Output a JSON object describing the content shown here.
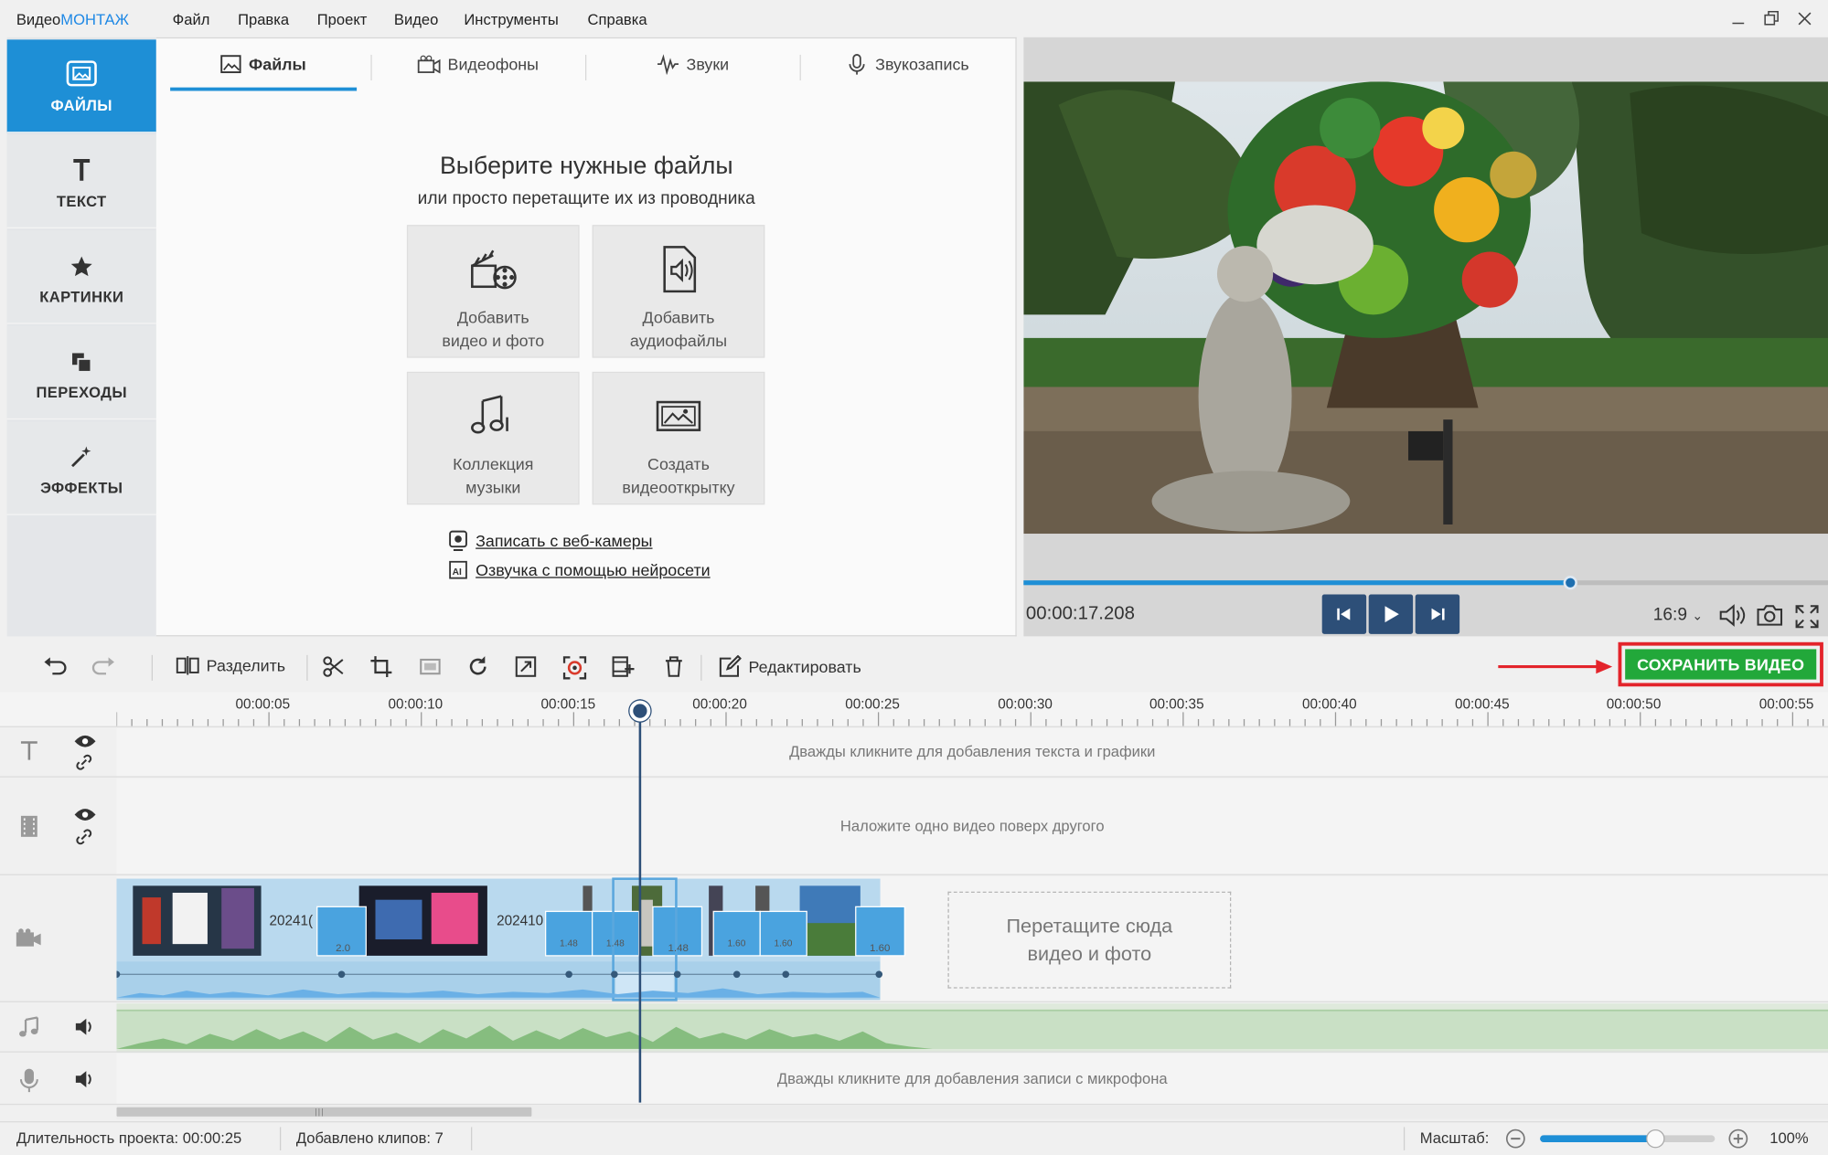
{
  "app": {
    "title_part1": "Видео",
    "title_part2": "МОНТАЖ"
  },
  "menu": [
    "Файл",
    "Правка",
    "Проект",
    "Видео",
    "Инструменты",
    "Справка"
  ],
  "rail": [
    {
      "label": "ФАЙЛЫ",
      "active": true
    },
    {
      "label": "ТЕКСТ"
    },
    {
      "label": "КАРТИНКИ"
    },
    {
      "label": "ПЕРЕХОДЫ"
    },
    {
      "label": "ЭФФЕКТЫ"
    }
  ],
  "tabs": [
    "Файлы",
    "Видеофоны",
    "Звуки",
    "Звукозапись"
  ],
  "files": {
    "heading": "Выберите нужные файлы",
    "subheading": "или просто перетащите их из проводника",
    "tiles": [
      {
        "line1": "Добавить",
        "line2": "видео и фото"
      },
      {
        "line1": "Добавить",
        "line2": "аудиофайлы"
      },
      {
        "line1": "Коллекция",
        "line2": "музыки"
      },
      {
        "line1": "Создать",
        "line2": "видеооткрытку"
      }
    ],
    "links": [
      "Записать с веб-камеры",
      "Озвучка с помощью нейросети"
    ]
  },
  "player": {
    "timecode": "00:00:17.208",
    "progress": 0.68,
    "ratio": "16:9"
  },
  "toolbar": {
    "split": "Разделить",
    "edit": "Редактировать",
    "save": "СОХРАНИТЬ ВИДЕО"
  },
  "ruler": [
    "00:00:05",
    "00:00:10",
    "00:00:15",
    "00:00:20",
    "00:00:25",
    "00:00:30",
    "00:00:35",
    "00:00:40",
    "00:00:45",
    "00:00:50",
    "00:00:55"
  ],
  "tracks": {
    "text_hint": "Дважды кликните для добавления текста и графики",
    "overlay_hint": "Наложите одно видео поверх другого",
    "drop_line1": "Перетащите сюда",
    "drop_line2": "видео и фото",
    "mic_hint": "Дважды кликните для добавления записи с микрофона",
    "clip_labels": [
      "20241(",
      "202410"
    ],
    "transition_labels": [
      "2.0",
      "1.48",
      "1.48",
      "1.48",
      "1.60",
      "1.60",
      "1.60"
    ]
  },
  "status": {
    "duration": "Длительность проекта:  00:00:25",
    "clips": "Добавлено клипов: 7",
    "zoom_label": "Масштаб:",
    "zoom_value": "100%",
    "zoom_level": 0.66
  },
  "colors": {
    "accent": "#1e8fd6",
    "save": "#22a83a",
    "highlight": "#e3242b",
    "player_button": "#2d4f78"
  }
}
